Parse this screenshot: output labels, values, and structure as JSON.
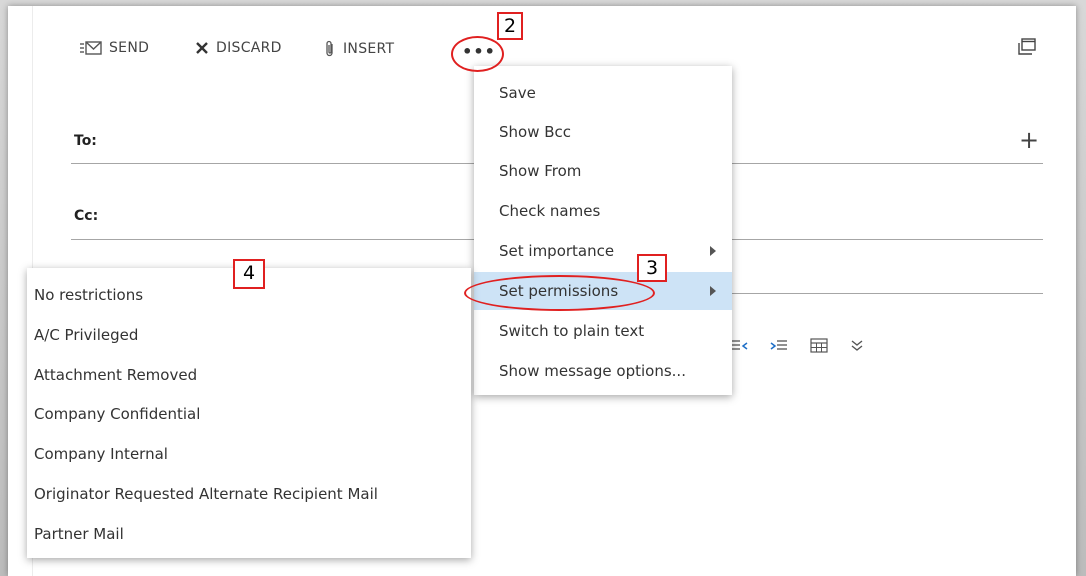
{
  "toolbar": {
    "send_label": "SEND",
    "discard_label": "DISCARD",
    "insert_label": "INSERT",
    "more_label": "•••",
    "icons": {
      "send": "send-icon",
      "discard": "close-icon",
      "insert": "paperclip-icon",
      "popout": "popout-icon"
    }
  },
  "fields": {
    "to_label": "To:",
    "cc_label": "Cc:",
    "add_icon": "+"
  },
  "more_menu": {
    "items": [
      {
        "label": "Save"
      },
      {
        "label": "Show Bcc"
      },
      {
        "label": "Show From"
      },
      {
        "label": "Check names"
      },
      {
        "label": "Set importance",
        "has_submenu": true
      },
      {
        "label": "Set permissions",
        "has_submenu": true,
        "active": true
      },
      {
        "label": "Switch to plain text"
      },
      {
        "label": "Show message options..."
      }
    ]
  },
  "permissions_submenu": {
    "items": [
      {
        "label": "No restrictions"
      },
      {
        "label": "A/C Privileged"
      },
      {
        "label": "Attachment Removed"
      },
      {
        "label": "Company Confidential"
      },
      {
        "label": "Company Internal"
      },
      {
        "label": "Originator Requested Alternate Recipient Mail"
      },
      {
        "label": "Partner Mail"
      }
    ]
  },
  "format_icons": [
    "outdent-icon",
    "indent-icon",
    "table-icon",
    "more-chevron-icon"
  ],
  "callouts": {
    "step2": "2",
    "step3": "3",
    "step4": "4"
  },
  "colors": {
    "highlight": "#cde3f6",
    "callout_red": "#e02020"
  }
}
